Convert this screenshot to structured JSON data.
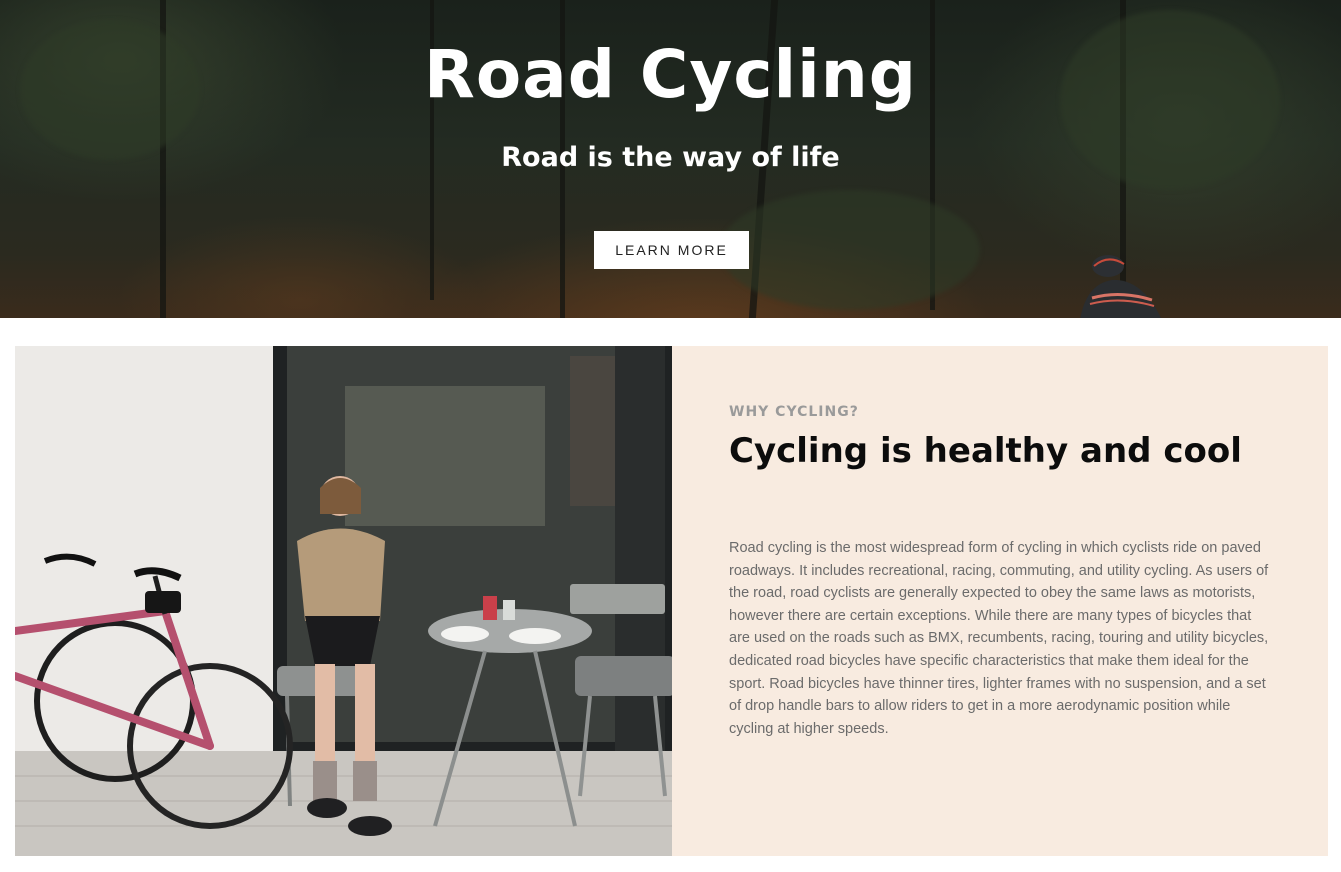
{
  "hero": {
    "title": "Road Cycling",
    "subtitle": "Road is the way of life",
    "button_label": "LEARN MORE"
  },
  "about": {
    "eyebrow": "WHY CYCLING?",
    "heading": "Cycling is healthy and cool",
    "body": "Road cycling is the most widespread form of cycling in which cyclists ride on paved roadways. It includes recreational, racing, commuting, and utility cycling. As users of the road, road cyclists are generally expected to obey the same laws as motorists, however there are certain exceptions. While there are many types of bicycles that are used on the roads such as BMX, recumbents, racing, touring and utility bicycles, dedicated road bicycles have specific characteristics that make them ideal for the sport. Road bicycles have thinner tires, lighter frames with no suspension, and a set of drop handle bars to allow riders to get in a more aerodynamic position while cycling at higher speeds."
  },
  "colors": {
    "panel_bg": "#f8ebe0",
    "heading": "#0c0c0c",
    "eyebrow": "#9a9a9a",
    "body_text": "#6b6b6b",
    "bike_frame": "#b5506e"
  }
}
